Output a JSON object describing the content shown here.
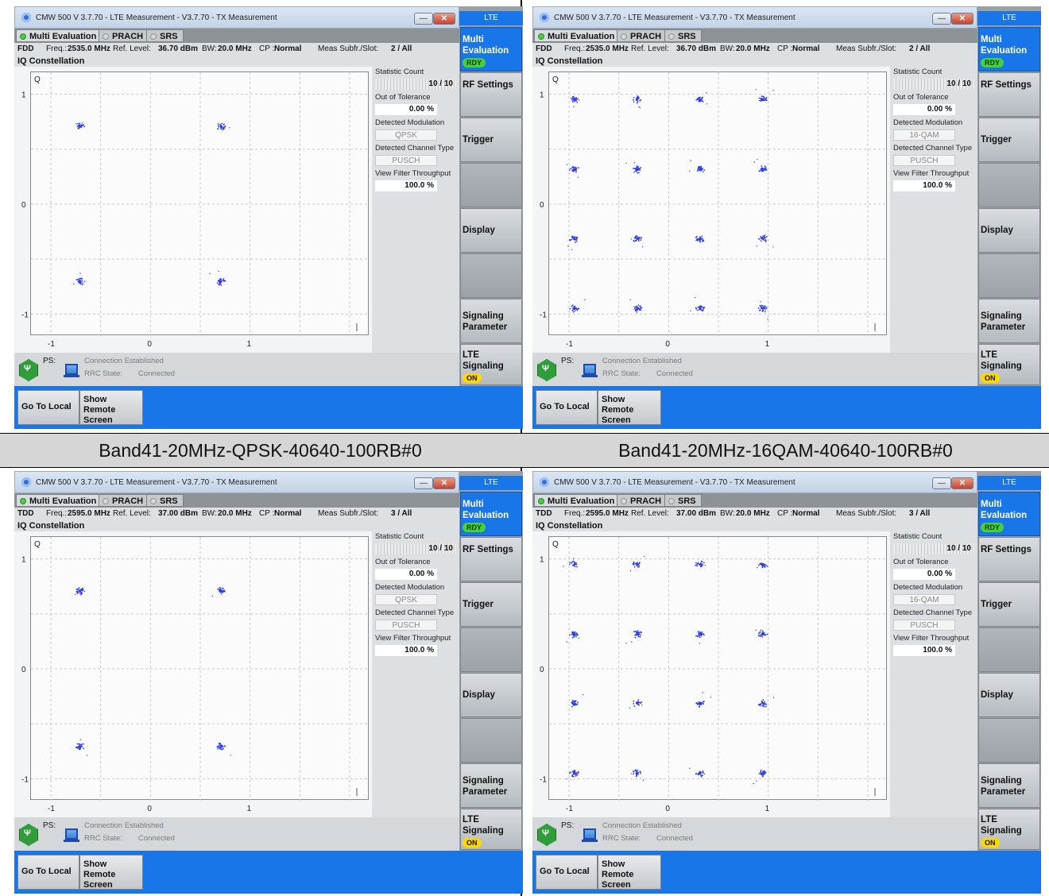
{
  "captions": [
    "Band41-20MHz-QPSK-40640-100RB#0",
    "Band41-20MHz-16QAM-40640-100RB#0"
  ],
  "colors": {
    "accent": "#1976e8",
    "constellation_point": "#2b3df2",
    "rdy": "#46d13c",
    "on": "#ffd800"
  },
  "panels": [
    {
      "title": "CMW 500 V 3.7.70 - LTE Measurement  - V3.7.70 - TX Measurement",
      "tabs": [
        "Multi Evaluation",
        "PRACH",
        "SRS"
      ],
      "duplex": "FDD",
      "freq_label": "Freq.:",
      "freq": "2535.0 MHz",
      "ref_label": "Ref. Level:",
      "ref": "36.70 dBm",
      "bw_label": "BW:",
      "bw": "20.0 MHz",
      "cp_label": "CP :",
      "cp": "Normal",
      "meas_label": "Meas Subfr./Slot:",
      "meas": "2   / All",
      "section": "IQ Constellation",
      "modulation": "QPSK",
      "statistic_count_label": "Statistic Count",
      "statistic_count": "10 / 10",
      "out_of_tolerance_label": "Out of Tolerance",
      "out_of_tolerance": "0.00  %",
      "detected_modulation_label": "Detected Modulation",
      "detected_modulation": "QPSK",
      "detected_channel_label": "Detected Channel Type",
      "detected_channel": "PUSCH",
      "view_filter_label": "View Filter Throughput",
      "view_filter": "100.0  %",
      "status": {
        "ps": "PS:",
        "connection": "Connection Established",
        "rrc_label": "RRC State:",
        "rrc": "Connected"
      },
      "softkeys": [
        "Go To Local",
        "Show Remote Screen"
      ],
      "side": {
        "lte": "LTE",
        "multi": "Multi Evaluation",
        "rdy": "RDY",
        "rf": "RF Settings",
        "trigger": "Trigger",
        "display": "Display",
        "signaling_param": "Signaling Parameter",
        "lte_signaling": "LTE Signaling",
        "on": "ON"
      }
    },
    {
      "title": "CMW 500 V 3.7.70 - LTE Measurement  - V3.7.70 - TX Measurement",
      "tabs": [
        "Multi Evaluation",
        "PRACH",
        "SRS"
      ],
      "duplex": "FDD",
      "freq_label": "Freq.:",
      "freq": "2535.0 MHz",
      "ref_label": "Ref. Level:",
      "ref": "36.70 dBm",
      "bw_label": "BW:",
      "bw": "20.0 MHz",
      "cp_label": "CP :",
      "cp": "Normal",
      "meas_label": "Meas Subfr./Slot:",
      "meas": "2   / All",
      "section": "IQ Constellation",
      "modulation": "16QAM",
      "statistic_count_label": "Statistic Count",
      "statistic_count": "10 / 10",
      "out_of_tolerance_label": "Out of Tolerance",
      "out_of_tolerance": "0.00  %",
      "detected_modulation_label": "Detected Modulation",
      "detected_modulation": "16-QAM",
      "detected_channel_label": "Detected Channel Type",
      "detected_channel": "PUSCH",
      "view_filter_label": "View Filter Throughput",
      "view_filter": "100.0  %",
      "status": {
        "ps": "PS:",
        "connection": "Connection Established",
        "rrc_label": "RRC State:",
        "rrc": "Connected"
      },
      "softkeys": [
        "Go To Local",
        "Show Remote Screen"
      ],
      "side": {
        "lte": "LTE",
        "multi": "Multi Evaluation",
        "rdy": "RDY",
        "rf": "RF Settings",
        "trigger": "Trigger",
        "display": "Display",
        "signaling_param": "Signaling Parameter",
        "lte_signaling": "LTE Signaling",
        "on": "ON"
      }
    },
    {
      "title": "CMW 500 V 3.7.70 - LTE Measurement  - V3.7.70 - TX Measurement",
      "tabs": [
        "Multi Evaluation",
        "PRACH",
        "SRS"
      ],
      "duplex": "TDD",
      "freq_label": "Freq.:",
      "freq": "2595.0 MHz",
      "ref_label": "Ref. Level:",
      "ref": "37.00 dBm",
      "bw_label": "BW:",
      "bw": "20.0 MHz",
      "cp_label": "CP :",
      "cp": "Normal",
      "meas_label": "Meas Subfr./Slot:",
      "meas": "3   / All",
      "section": "IQ Constellation",
      "modulation": "QPSK",
      "statistic_count_label": "Statistic Count",
      "statistic_count": "10 / 10",
      "out_of_tolerance_label": "Out of Tolerance",
      "out_of_tolerance": "0.00  %",
      "detected_modulation_label": "Detected Modulation",
      "detected_modulation": "QPSK",
      "detected_channel_label": "Detected Channel Type",
      "detected_channel": "PUSCH",
      "view_filter_label": "View Filter Throughput",
      "view_filter": "100.0  %",
      "status": {
        "ps": "PS:",
        "connection": "Connection Established",
        "rrc_label": "RRC State:",
        "rrc": "Connected"
      },
      "softkeys": [
        "Go To Local",
        "Show Remote Screen"
      ],
      "side": {
        "lte": "LTE",
        "multi": "Multi Evaluation",
        "rdy": "RDY",
        "rf": "RF Settings",
        "trigger": "Trigger",
        "display": "Display",
        "signaling_param": "Signaling Parameter",
        "lte_signaling": "LTE Signaling",
        "on": "ON"
      }
    },
    {
      "title": "CMW 500 V 3.7.70 - LTE Measurement  - V3.7.70 - TX Measurement",
      "tabs": [
        "Multi Evaluation",
        "PRACH",
        "SRS"
      ],
      "duplex": "TDD",
      "freq_label": "Freq.:",
      "freq": "2595.0 MHz",
      "ref_label": "Ref. Level:",
      "ref": "37.00 dBm",
      "bw_label": "BW:",
      "bw": "20.0 MHz",
      "cp_label": "CP :",
      "cp": "Normal",
      "meas_label": "Meas Subfr./Slot:",
      "meas": "3   / All",
      "section": "IQ Constellation",
      "modulation": "16QAM",
      "statistic_count_label": "Statistic Count",
      "statistic_count": "10 / 10",
      "out_of_tolerance_label": "Out of Tolerance",
      "out_of_tolerance": "0.00  %",
      "detected_modulation_label": "Detected Modulation",
      "detected_modulation": "16-QAM",
      "detected_channel_label": "Detected Channel Type",
      "detected_channel": "PUSCH",
      "view_filter_label": "View Filter Throughput",
      "view_filter": "100.0  %",
      "status": {
        "ps": "PS:",
        "connection": "Connection Established",
        "rrc_label": "RRC State:",
        "rrc": "Connected"
      },
      "softkeys": [
        "Go To Local",
        "Show Remote Screen"
      ],
      "side": {
        "lte": "LTE",
        "multi": "Multi Evaluation",
        "rdy": "RDY",
        "rf": "RF Settings",
        "trigger": "Trigger",
        "display": "Display",
        "signaling_param": "Signaling Parameter",
        "lte_signaling": "LTE Signaling",
        "on": "ON"
      }
    }
  ],
  "chart_data": {
    "type": "scatter",
    "ylabel": "Q",
    "xlim": [
      -1.2,
      2.2
    ],
    "ylim": [
      -1.2,
      1.2
    ],
    "x_ticks": [
      "-1",
      "0",
      "1"
    ],
    "y_ticks": [
      "1",
      "0",
      "-1"
    ],
    "grid": true,
    "series": [
      {
        "modulation": "QPSK",
        "points": [
          [
            -0.707,
            0.707
          ],
          [
            0.707,
            0.707
          ],
          [
            -0.707,
            -0.707
          ],
          [
            0.707,
            -0.707
          ]
        ]
      },
      {
        "modulation": "16-QAM",
        "points": [
          [
            -0.949,
            0.949
          ],
          [
            -0.316,
            0.949
          ],
          [
            0.316,
            0.949
          ],
          [
            0.949,
            0.949
          ],
          [
            -0.949,
            0.316
          ],
          [
            -0.316,
            0.316
          ],
          [
            0.316,
            0.316
          ],
          [
            0.949,
            0.316
          ],
          [
            -0.949,
            -0.316
          ],
          [
            -0.316,
            -0.316
          ],
          [
            0.316,
            -0.316
          ],
          [
            0.949,
            -0.316
          ],
          [
            -0.949,
            -0.949
          ],
          [
            -0.316,
            -0.949
          ],
          [
            0.316,
            -0.949
          ],
          [
            0.949,
            -0.949
          ]
        ]
      }
    ]
  }
}
